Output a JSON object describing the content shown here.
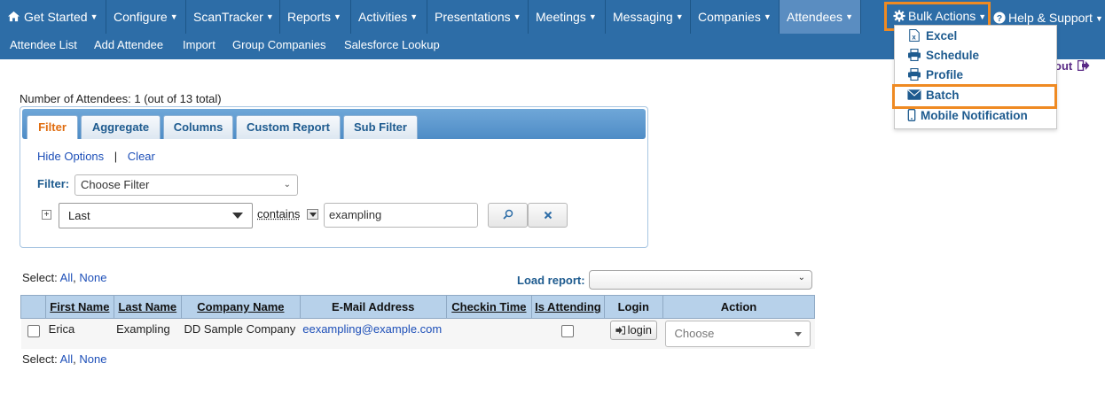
{
  "nav": {
    "items": [
      {
        "label": "Get Started"
      },
      {
        "label": "Configure"
      },
      {
        "label": "ScanTracker"
      },
      {
        "label": "Reports"
      },
      {
        "label": "Activities"
      },
      {
        "label": "Presentations"
      },
      {
        "label": "Meetings"
      },
      {
        "label": "Messaging"
      },
      {
        "label": "Companies"
      },
      {
        "label": "Attendees"
      }
    ],
    "bulk_actions": "Bulk Actions",
    "help": "Help & Support"
  },
  "subnav": {
    "items": [
      {
        "label": "Attendee List"
      },
      {
        "label": "Add Attendee"
      },
      {
        "label": "Import"
      },
      {
        "label": "Group Companies"
      },
      {
        "label": "Salesforce Lookup"
      }
    ]
  },
  "bulk_menu": {
    "items": [
      {
        "label": "Excel",
        "icon": "excel-icon"
      },
      {
        "label": "Schedule",
        "icon": "printer-icon"
      },
      {
        "label": "Profile",
        "icon": "printer-icon"
      },
      {
        "label": "Batch",
        "icon": "envelope-icon"
      },
      {
        "label": "Mobile Notification",
        "icon": "mobile-icon"
      }
    ]
  },
  "logout": "out",
  "summary": {
    "count_text": "Number of Attendees: 1 (out of 13 total)"
  },
  "tabs": [
    {
      "label": "Filter"
    },
    {
      "label": "Aggregate"
    },
    {
      "label": "Columns"
    },
    {
      "label": "Custom Report"
    },
    {
      "label": "Sub Filter"
    }
  ],
  "filter": {
    "hide_options": "Hide Options",
    "separator": "|",
    "clear": "Clear",
    "filter_label": "Filter:",
    "choose_filter": "Choose Filter",
    "field": "Last",
    "operator": "contains",
    "value": "exampling"
  },
  "results": {
    "select_label": "Select:",
    "all": "All",
    "none": "None",
    "load_report": "Load report:",
    "columns": [
      "First Name",
      "Last Name",
      "Company Name",
      "E-Mail Address",
      "Checkin Time",
      "Is Attending",
      "Login",
      "Action"
    ],
    "rows": [
      {
        "first": "Erica",
        "last": "Exampling",
        "company": "DD Sample Company",
        "email": "eexampling@example.com",
        "checkin": "",
        "login": "login",
        "action": "Choose"
      }
    ]
  },
  "colors": {
    "nav_bg": "#2d6da7",
    "highlight": "#ef8a22",
    "link": "#1d4fb8",
    "header_bg": "#b7d1ea"
  }
}
